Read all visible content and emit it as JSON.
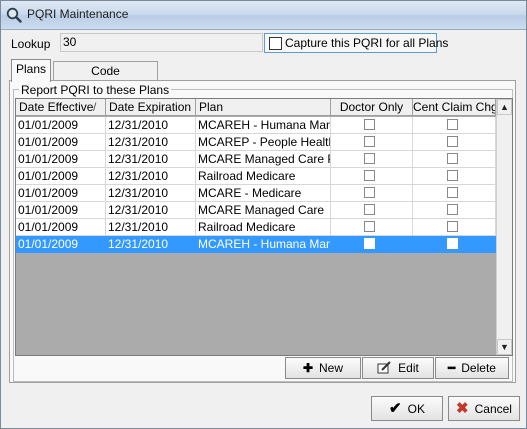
{
  "window": {
    "title": "PQRI Maintenance"
  },
  "lookup": {
    "label": "Lookup",
    "value": "30"
  },
  "capture": {
    "label": "Capture this PQRI for all Plans",
    "checked": false
  },
  "tabs": [
    {
      "label": "Plans",
      "active": true
    },
    {
      "label": "Code Requirements",
      "active": false
    }
  ],
  "group": {
    "legend": "Report PQRI to these Plans"
  },
  "grid": {
    "columns": [
      "Date Effective",
      "Date Expiration",
      "Plan",
      "Doctor Only",
      "Cent Claim Chgs"
    ],
    "sort_indicator": "/",
    "rows": [
      {
        "eff": "01/01/2009",
        "exp": "12/31/2010",
        "plan": "MCAREH - Humana Manag",
        "doctor_only": false,
        "cent_claim": false
      },
      {
        "eff": "01/01/2009",
        "exp": "12/31/2010",
        "plan": "MCAREP - People Health T",
        "doctor_only": false,
        "cent_claim": false
      },
      {
        "eff": "01/01/2009",
        "exp": "12/31/2010",
        "plan": "MCARE Managed Care Plar",
        "doctor_only": false,
        "cent_claim": false
      },
      {
        "eff": "01/01/2009",
        "exp": "12/31/2010",
        "plan": "Railroad Medicare",
        "doctor_only": false,
        "cent_claim": false
      },
      {
        "eff": "01/01/2009",
        "exp": "12/31/2010",
        "plan": "MCARE - Medicare",
        "doctor_only": false,
        "cent_claim": false
      },
      {
        "eff": "01/01/2009",
        "exp": "12/31/2010",
        "plan": "MCARE Managed Care",
        "doctor_only": false,
        "cent_claim": false
      },
      {
        "eff": "01/01/2009",
        "exp": "12/31/2010",
        "plan": "Railroad Medicare",
        "doctor_only": false,
        "cent_claim": false
      },
      {
        "eff": "01/01/2009",
        "exp": "12/31/2010",
        "plan": "MCAREH - Humana Manag",
        "doctor_only": false,
        "cent_claim": false,
        "selected": true
      }
    ]
  },
  "buttons": {
    "new": {
      "label": "New",
      "icon": "plus-icon"
    },
    "edit": {
      "label": "Edit",
      "icon": "edit-pencil-icon"
    },
    "delete": {
      "label": "Delete",
      "icon": "minus-icon"
    },
    "ok": {
      "label": "OK",
      "icon": "checkmark-icon"
    },
    "cancel": {
      "label": "Cancel",
      "icon": "x-icon"
    }
  },
  "colors": {
    "selection": "#3399ff",
    "capture_border": "#5c9bd6",
    "cancel_icon": "#c0392b"
  }
}
